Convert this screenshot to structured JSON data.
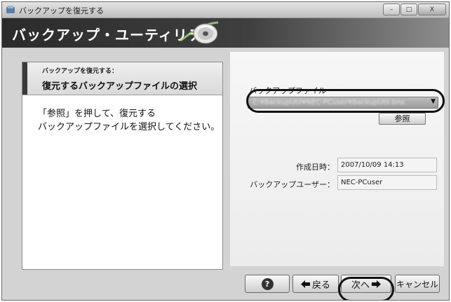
{
  "window": {
    "title": "バックアップを復元する",
    "minimize": "–",
    "maximize": "□",
    "close": "X"
  },
  "banner": {
    "title": "バックアップ・ユーティリティ"
  },
  "left_panel": {
    "subtitle": "バックアップを復元する：",
    "title": "復元するバックアップファイルの選択",
    "description_line1": "「参照」を押して、復元する",
    "description_line2": "バックアップファイルを選択してください。"
  },
  "right_panel": {
    "file_label": "バックアップファイル",
    "file_value": "C:¥BackupUtil¥NEC-PCuser¥BackupUtil.bnx",
    "browse_label": "参照",
    "date_label": "作成日時：",
    "date_value": "2007/10/09 14:13",
    "user_label": "バックアップユーザー：",
    "user_value": "NEC-PCuser"
  },
  "footer": {
    "help": "?",
    "back_label": "戻る",
    "next_label": "次へ",
    "cancel_label": "キャンセル"
  },
  "icons": {
    "app": "app-icon",
    "disc": "cd-disc-icon",
    "back": "arrow-left-icon",
    "next": "arrow-right-icon",
    "dropdown": "chevron-down-icon"
  }
}
